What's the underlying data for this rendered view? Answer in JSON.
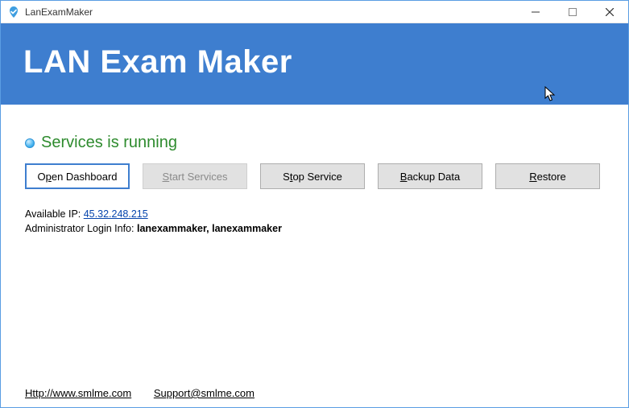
{
  "titlebar": {
    "app_name": "LanExamMaker"
  },
  "hero": {
    "title": "LAN Exam Maker"
  },
  "status": {
    "text": "Services is running"
  },
  "buttons": {
    "open_dashboard": {
      "pre": "O",
      "u": "p",
      "post": "en Dashboard"
    },
    "start_services": {
      "pre": "",
      "u": "S",
      "post": "tart Services"
    },
    "stop_service": {
      "pre": "S",
      "u": "t",
      "post": "op Service"
    },
    "backup_data": {
      "pre": "",
      "u": "B",
      "post": "ackup Data"
    },
    "restore": {
      "pre": "",
      "u": "R",
      "post": "estore"
    }
  },
  "info": {
    "ip_label": "Available IP:  ",
    "ip_value": "45.32.248.215",
    "admin_label": "Administrator Login Info:   ",
    "admin_value": "lanexammaker, lanexammaker"
  },
  "footer": {
    "homepage": "Http://www.smlme.com",
    "support": "Support@smlme.com"
  }
}
